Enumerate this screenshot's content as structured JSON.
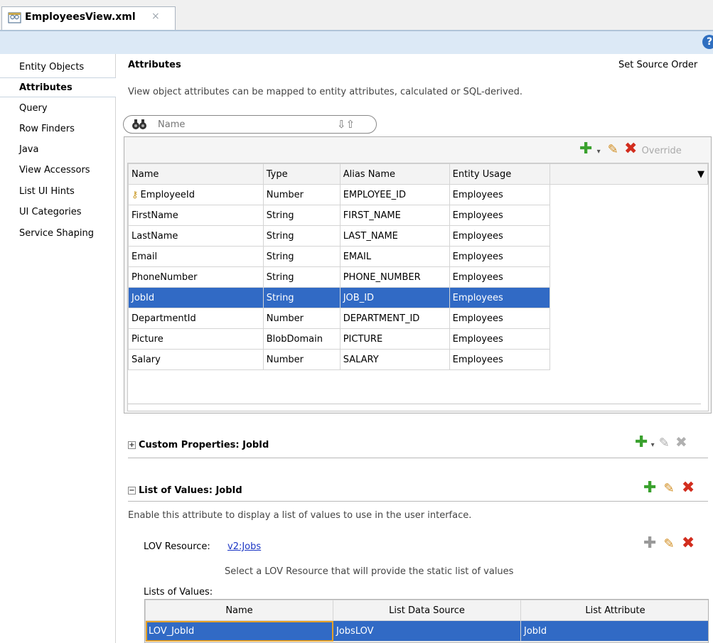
{
  "tab": {
    "title": "EmployeesView.xml",
    "close": "×"
  },
  "help": "?",
  "sidebar": {
    "items": [
      {
        "label": "Entity Objects"
      },
      {
        "label": "Attributes"
      },
      {
        "label": "Query"
      },
      {
        "label": "Row Finders"
      },
      {
        "label": "Java"
      },
      {
        "label": "View Accessors"
      },
      {
        "label": "List UI Hints"
      },
      {
        "label": "UI Categories"
      },
      {
        "label": "Service Shaping"
      }
    ]
  },
  "attributes": {
    "title": "Attributes",
    "set_source_order": "Set Source Order",
    "description": "View object attributes can be mapped to entity attributes, calculated or SQL-derived.",
    "search_placeholder": "Name",
    "override_label": "Override",
    "columns": [
      "Name",
      "Type",
      "Alias Name",
      "Entity Usage"
    ],
    "rows": [
      {
        "name": "EmployeeId",
        "type": "Number",
        "alias": "EMPLOYEE_ID",
        "usage": "Employees",
        "key": true
      },
      {
        "name": "FirstName",
        "type": "String",
        "alias": "FIRST_NAME",
        "usage": "Employees"
      },
      {
        "name": "LastName",
        "type": "String",
        "alias": "LAST_NAME",
        "usage": "Employees"
      },
      {
        "name": "Email",
        "type": "String",
        "alias": "EMAIL",
        "usage": "Employees"
      },
      {
        "name": "PhoneNumber",
        "type": "String",
        "alias": "PHONE_NUMBER",
        "usage": "Employees"
      },
      {
        "name": "JobId",
        "type": "String",
        "alias": "JOB_ID",
        "usage": "Employees",
        "selected": true
      },
      {
        "name": "DepartmentId",
        "type": "Number",
        "alias": "DEPARTMENT_ID",
        "usage": "Employees"
      },
      {
        "name": "Picture",
        "type": "BlobDomain",
        "alias": "PICTURE",
        "usage": "Employees"
      },
      {
        "name": "Salary",
        "type": "Number",
        "alias": "SALARY",
        "usage": "Employees"
      }
    ]
  },
  "custom_properties": {
    "title": "Custom Properties: JobId",
    "toggle": "+"
  },
  "lov": {
    "title": "List of Values: JobId",
    "toggle": "−",
    "description": "Enable this attribute to display a list of values to use in the user interface.",
    "resource_label": "LOV Resource:",
    "resource_link": "v2:Jobs",
    "resource_hint": "Select a LOV Resource that will provide the static list of values",
    "lists_label": "Lists of Values:",
    "columns": [
      "Name",
      "List Data Source",
      "List Attribute"
    ],
    "rows": [
      {
        "name": "LOV_JobId",
        "source": "JobsLOV",
        "attribute": "JobId"
      }
    ]
  },
  "colors": {
    "selection": "#316ac5",
    "add": "#3aa12e",
    "delete": "#d22d1e",
    "edit": "#d08a1a",
    "link": "#1a35c4"
  }
}
